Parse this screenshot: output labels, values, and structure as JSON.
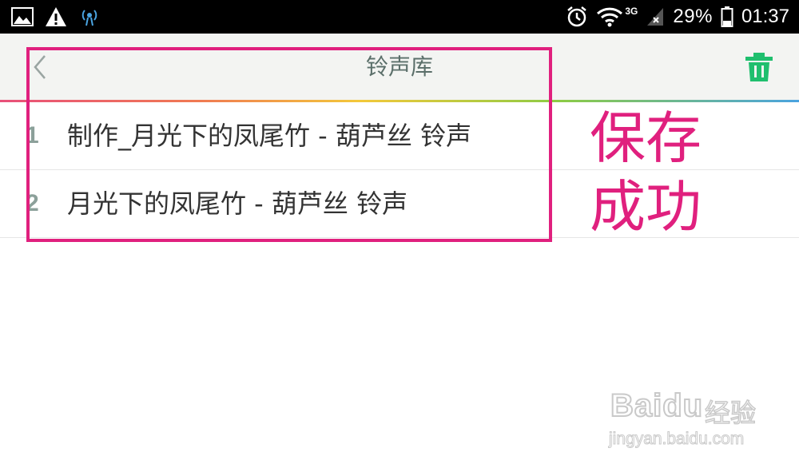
{
  "status_bar": {
    "battery": "29%",
    "time": "01:37",
    "network": "3G"
  },
  "header": {
    "title": "铃声库"
  },
  "ringtones": [
    {
      "index": "1",
      "name": "制作_月光下的凤尾竹 - 葫芦丝 铃声"
    },
    {
      "index": "2",
      "name": "月光下的凤尾竹 - 葫芦丝 铃声"
    }
  ],
  "annotation": {
    "line1": "保存",
    "line2": "成功"
  },
  "watermark": {
    "logo": "Baidu",
    "brand": "经验",
    "url": "jingyan.baidu.com"
  },
  "colors": {
    "accent_green": "#1fbf6e",
    "annotation_pink": "#e0207e"
  }
}
